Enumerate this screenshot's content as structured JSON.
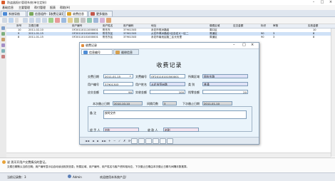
{
  "window": {
    "title": "防盗器报价管理系统(单位定制)"
  },
  "menu": [
    "基础信息",
    "主要管理",
    "帮付管理",
    "报表",
    "帮助(H)"
  ],
  "tabs": [
    {
      "label": "系统导航",
      "icon": "home-icon"
    },
    {
      "label": "信息组件-【收费记录】",
      "icon": "grid-icon"
    },
    {
      "label": "收费信息",
      "icon": "money-icon"
    },
    {
      "label": "更多服务",
      "icon": "person-icon"
    }
  ],
  "grid": {
    "headers": [
      "序号",
      "交费日期",
      "用户编号",
      "用户姓名",
      "用户编码",
      "地址",
      "缴费区域",
      "应交金额",
      "标识",
      "审核",
      "实收金额"
    ],
    "rows": [
      [
        "10",
        "2011-02-10",
        "OF20110111000001",
        "陈东东",
        "37901303",
        "永花市恒洲路组",
        "周口区",
        "",
        "",
        "",
        "10"
      ],
      [
        "9",
        "2011-01-15",
        "OF20110101000001",
        "陈东东区",
        "37901303",
        "从花市博洲路组1区自定义一区二",
        "周道区",
        "",
        "90",
        "3",
        "8"
      ],
      [
        "8",
        "2011-01-15",
        "OF20110101000001",
        "陈东东区",
        "37901303",
        "永花市南池区路二区长安里",
        "周道区",
        "",
        "90",
        "3",
        "8"
      ]
    ]
  },
  "dialog": {
    "title": "收费记录",
    "tabs": [
      {
        "label": "信息编号",
        "icon": "info-icon"
      },
      {
        "label": "维修信息",
        "icon": "wrench-icon"
      }
    ],
    "heading": "收费记录",
    "fields": {
      "pay_date_label": "交费日期",
      "pay_date": "2011-01-15",
      "doc_no_label": "文费编号",
      "doc_no": "OF20110101500001",
      "area_label": "所属区域",
      "area": "周庆东路",
      "user_no_label": "用户编号",
      "user_no": "37901303",
      "user_name_label": "用户姓名",
      "user_name": "从花市恒洲路",
      "type_label": "类   别",
      "type": "普通",
      "due_label": "应交金额",
      "due": "90",
      "paid_label": "实收金额",
      "paid": "100",
      "change_label": "找零金额",
      "change": "20",
      "this_date_label": "本次缴止日期",
      "this_date": "2010-10-10",
      "period_label": "间隔月数",
      "period": "3",
      "next_date_label": "下次缴止日期",
      "next_date": "2011-01-10",
      "note_label": "备   注",
      "note": "按时交齐",
      "handler_label": "经 手 人",
      "handler": "刘东",
      "payee_label": "收   款 人",
      "payee": "赵刚"
    },
    "nav": [
      "◄◄",
      "◄",
      "►",
      "►►",
      "+",
      "−",
      "✓",
      "✗",
      "⟳"
    ]
  },
  "status": {
    "line1": "说 男牙开用户交费情况的登记。",
    "line2": "交费日期默认当前日期；用户编号显示后自动读出相关信息；所属区域、用户编号、用户姓名与客户资料相对应，下次缴止日期由本次缴止日期与间隔月数推算。"
  },
  "taskbar": {
    "left": "当前记录数：3",
    "user": "Admin",
    "right": "欢迎使用本系统产品!"
  }
}
